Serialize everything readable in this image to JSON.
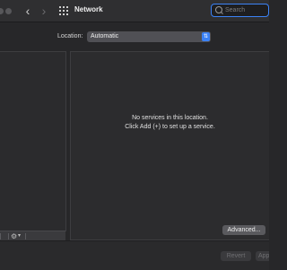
{
  "window": {
    "title": "Network"
  },
  "toolbar": {
    "back_icon": "chevron-left-icon",
    "forward_icon": "chevron-right-icon",
    "grid_icon": "grid-icon",
    "search_placeholder": "Search",
    "back_glyph": "‹",
    "forward_glyph": "›"
  },
  "location": {
    "label": "Location:",
    "selected": "Automatic",
    "chevron_glyph": "⇅"
  },
  "services_panel": {
    "empty_line1": "No services in this location.",
    "empty_line2": "Click Add (+) to set up a service."
  },
  "left_toolbar": {
    "gear_glyph": "⚙",
    "caret_glyph": "▾"
  },
  "buttons": {
    "advanced": "Advanced...",
    "revert": "Revert",
    "apply": "Apply"
  },
  "colors": {
    "accent": "#3b82f6",
    "window_bg": "#272729",
    "panel_bg": "#2c2c2e"
  }
}
